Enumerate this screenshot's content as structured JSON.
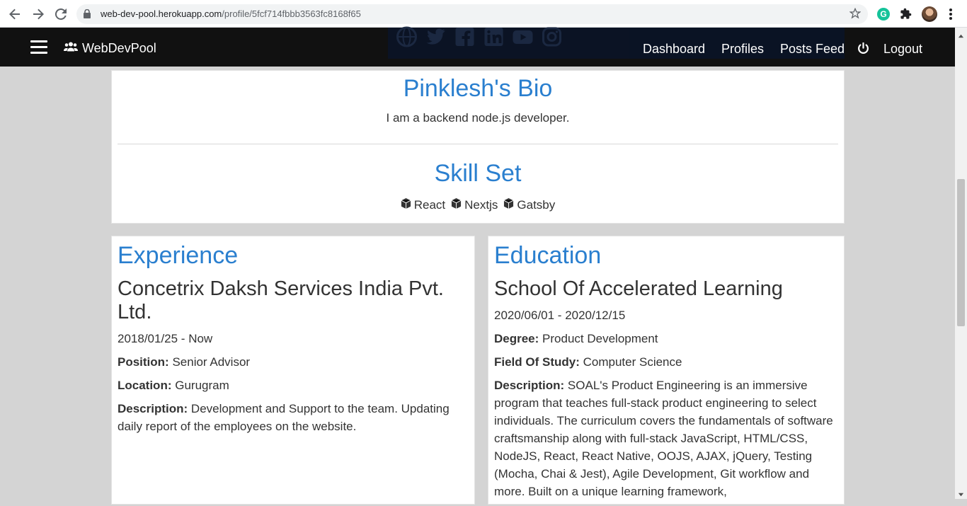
{
  "browser": {
    "url_host": "web-dev-pool.herokuapp.com",
    "url_path": "/profile/5fcf714fbbb3563fc8168f65"
  },
  "navbar": {
    "brand": "WebDevPool",
    "links": [
      "Dashboard",
      "Profiles",
      "Posts Feed",
      "Logout"
    ]
  },
  "bio": {
    "title": "Pinklesh's Bio",
    "text": "I am a backend node.js developer.",
    "skills_title": "Skill Set",
    "skills": [
      "React",
      "Nextjs",
      "Gatsby"
    ]
  },
  "experience": {
    "title": "Experience",
    "company": "Concetrix Daksh Services India Pvt. Ltd.",
    "dates": "2018/01/25 - Now",
    "position_label": "Position:",
    "position": "Senior Advisor",
    "location_label": "Location:",
    "location": "Gurugram",
    "description_label": "Description:",
    "description": "Development and Support to the team. Updating daily report of the employees on the website."
  },
  "education": {
    "title": "Education",
    "school": "School Of Accelerated Learning",
    "dates": "2020/06/01 - 2020/12/15",
    "degree_label": "Degree:",
    "degree": "Product Development",
    "field_label": "Field Of Study:",
    "field": "Computer Science",
    "description_label": "Description:",
    "description": "SOAL's Product Engineering is an immersive program that teaches full-stack product engineering to select individuals. The curriculum covers the fundamentals of software craftsmanship along with full-stack JavaScript, HTML/CSS, NodeJS, React, React Native, OOJS, AJAX, jQuery, Testing (Mocha, Chai & Jest), Agile Development, Git workflow and more. Built on a unique learning framework,"
  },
  "colors": {
    "accent": "#2a7fcf",
    "navbar_bg": "#111111",
    "page_bg": "#d4d4d4"
  }
}
